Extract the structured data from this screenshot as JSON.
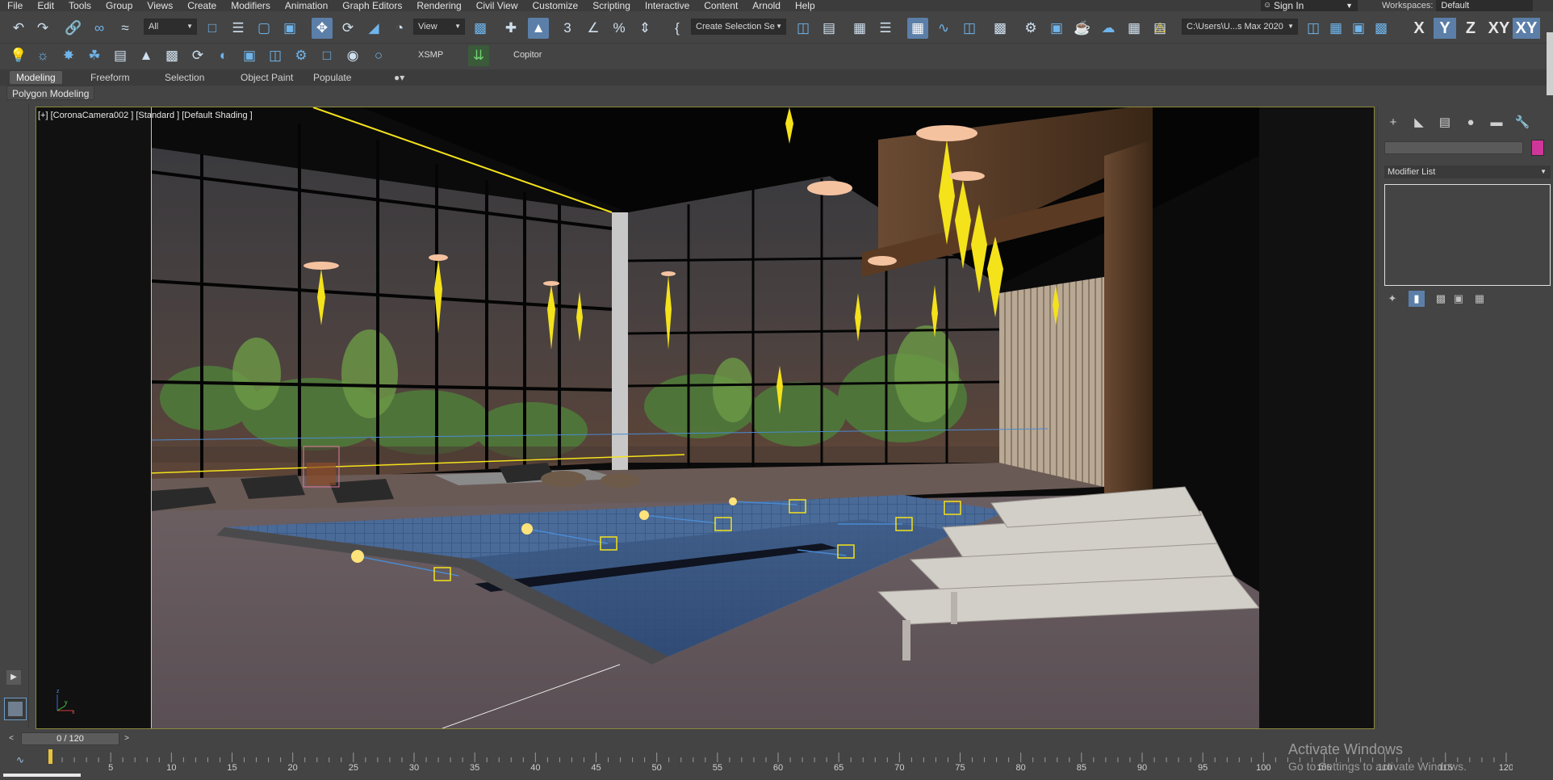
{
  "menu": [
    "File",
    "Edit",
    "Tools",
    "Group",
    "Views",
    "Create",
    "Modifiers",
    "Animation",
    "Graph Editors",
    "Rendering",
    "Civil View",
    "Customize",
    "Scripting",
    "Interactive",
    "Content",
    "Arnold",
    "Help"
  ],
  "signin": {
    "label": "Sign In"
  },
  "workspaces": {
    "label": "Workspaces:",
    "value": "Default"
  },
  "toolbar1": {
    "filter_select": "All",
    "refcoord_select": "View",
    "named_selection": "Create Selection Se",
    "project_path": "C:\\Users\\U...s Max 2020",
    "axis_x": "X",
    "axis_y": "Y",
    "axis_z": "Z",
    "axis_xy": "XY",
    "axis_xy2": "XY"
  },
  "toolbar2": {
    "xsmp": "XSMP",
    "copitor": "Copitor"
  },
  "ribbon": {
    "tabs": [
      "Modeling",
      "Freeform",
      "Selection",
      "Object Paint",
      "Populate"
    ],
    "panel_button": "Polygon Modeling"
  },
  "viewport": {
    "label": "[+] [CoronaCamera002 ] [Standard ] [Default Shading ]"
  },
  "command_panel": {
    "modifier_list": "Modifier List"
  },
  "timeline": {
    "frame_display": "0 / 120",
    "prev": "<",
    "next": ">",
    "ruler_labels": [
      "5",
      "10",
      "15",
      "20",
      "25",
      "30",
      "35",
      "40",
      "45",
      "50",
      "55",
      "60",
      "65",
      "70",
      "75",
      "80",
      "85",
      "90",
      "95",
      "100",
      "105",
      "110",
      "115",
      "120"
    ]
  },
  "watermark": {
    "title": "Activate Windows",
    "subtitle": "Go to Settings to activate Windows."
  },
  "colors": {
    "accent": "#5b7fa8",
    "viewport_border": "#8a8a3a",
    "object_color": "#d0359a",
    "light_yellow": "#f4e21b"
  }
}
